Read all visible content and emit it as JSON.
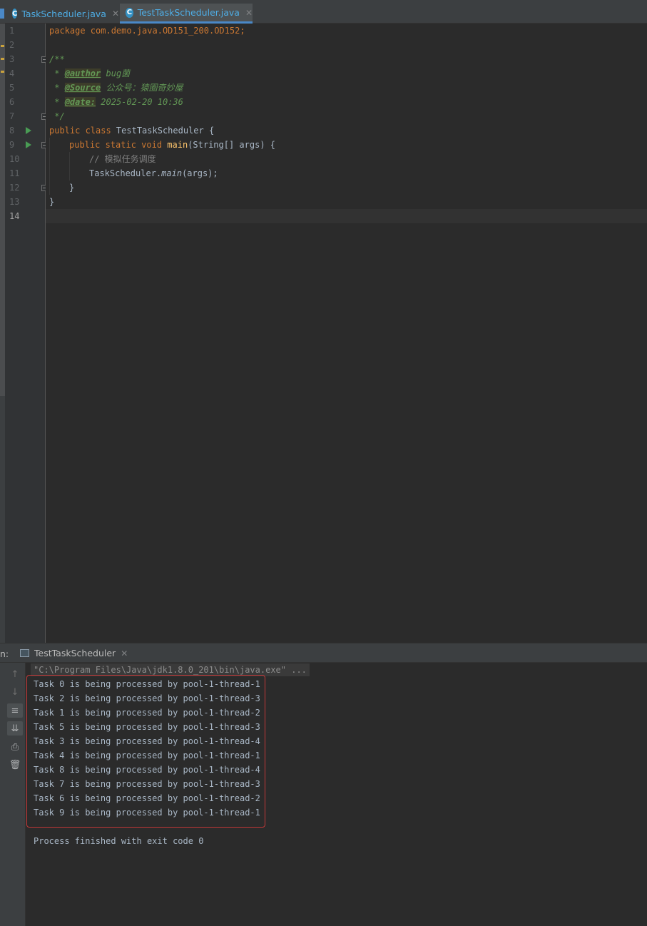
{
  "tabs": [
    {
      "label": "TaskScheduler.java",
      "icon": "java-class-icon",
      "active": false
    },
    {
      "label": "TestTaskScheduler.java",
      "icon": "java-class-icon",
      "active": true
    }
  ],
  "editor": {
    "current_line": "14",
    "line_numbers": [
      "1",
      "2",
      "3",
      "4",
      "5",
      "6",
      "7",
      "8",
      "9",
      "10",
      "11",
      "12",
      "13",
      "14"
    ],
    "code": {
      "l1_kw": "package",
      "l1_rest": " com.demo.java.OD151_200.OD152;",
      "l3": "/**",
      "l4_star": " * ",
      "l4_tag": "@author",
      "l4_val": " bug菌",
      "l5_star": " * ",
      "l5_tag": "@Source",
      "l5_val": " 公众号：猿圈奇妙屋",
      "l6_star": " * ",
      "l6_tag": "@date:",
      "l6_val": " 2025-02-20 10:36",
      "l7": " */",
      "l8_kw": "public class ",
      "l8_name": "TestTaskScheduler {",
      "l9_kw": "public static void ",
      "l9_fn": "main",
      "l9_rest": "(String[] args) {",
      "l10": "// 模拟任务调度",
      "l11_cls": "TaskScheduler.",
      "l11_fn": "main",
      "l11_rest": "(args);",
      "l12": "}",
      "l13": "}"
    }
  },
  "run_panel": {
    "prefix": "n:",
    "tab_label": "TestTaskScheduler",
    "command": "\"C:\\Program Files\\Java\\jdk1.8.0_201\\bin\\java.exe\" ...",
    "output": [
      "Task 0 is being processed by pool-1-thread-1",
      "Task 2 is being processed by pool-1-thread-3",
      "Task 1 is being processed by pool-1-thread-2",
      "Task 5 is being processed by pool-1-thread-3",
      "Task 3 is being processed by pool-1-thread-4",
      "Task 4 is being processed by pool-1-thread-1",
      "Task 8 is being processed by pool-1-thread-4",
      "Task 7 is being processed by pool-1-thread-3",
      "Task 6 is being processed by pool-1-thread-2",
      "Task 9 is being processed by pool-1-thread-1"
    ],
    "exit_message": "Process finished with exit code 0",
    "toolbar": [
      "up-arrow-icon",
      "down-arrow-icon",
      "soft-wrap-icon",
      "scroll-to-end-icon",
      "print-icon",
      "trash-icon"
    ]
  },
  "colors": {
    "highlight_box": "#c23838",
    "accent": "#4a88c7",
    "keyword": "#cc7832",
    "doc_comment": "#629755"
  }
}
